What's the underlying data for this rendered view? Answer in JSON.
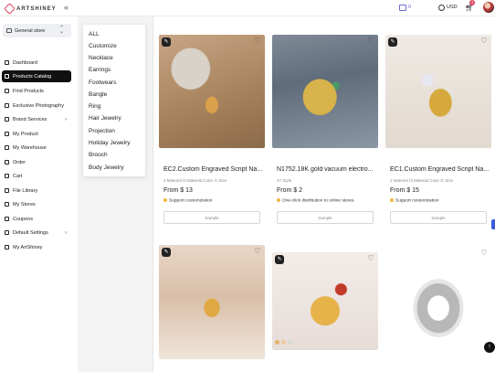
{
  "app": {
    "logo_text": "ARTSHINEY",
    "collapse_icon": "double-chevron-left"
  },
  "topbar": {
    "box_count": "0",
    "currency": "USD",
    "cart_badge": "3"
  },
  "sidebar": {
    "store_label": "General store",
    "items": [
      {
        "label": "Dashboard"
      },
      {
        "label": "Products Catalog",
        "active": true
      },
      {
        "label": "Find Products"
      },
      {
        "label": "Exclusive Photography"
      },
      {
        "label": "Brand Services",
        "has_submenu": true
      },
      {
        "label": "My Product"
      },
      {
        "label": "My Warehouse"
      },
      {
        "label": "Order"
      },
      {
        "label": "Cart"
      },
      {
        "label": "File Library"
      },
      {
        "label": "My Stores"
      },
      {
        "label": "Coupons"
      },
      {
        "label": "Default Settings",
        "has_submenu": true
      },
      {
        "label": "My ArtShiney"
      }
    ]
  },
  "category_menu": {
    "items": [
      "ALL",
      "Customize",
      "Necklace",
      "Earrings",
      "Footwears",
      "Bangle",
      "Ring",
      "Hair Jewelry",
      "Projection",
      "Holiday Jewelry",
      "Brooch",
      "Body Jewelry"
    ]
  },
  "products": [
    {
      "title": "EC2.Custom Engraved Script Na...",
      "meta": "2 Material /3 Material Color /1 Size",
      "price": "From $ 13",
      "note": "Support customization",
      "button": "Sample",
      "customizable": true
    },
    {
      "title": "N1752.18K gold vacuum electro...",
      "meta": "47 Style",
      "price": "From $ 2",
      "note": "One-click distribution to online stores",
      "button": "Sample",
      "customizable": false
    },
    {
      "title": "EC1.Custom Engraved Script Na...",
      "meta": "1 Material /3 Material Color /1 Size",
      "price": "From $ 15",
      "note": "Support customization",
      "button": "Sample",
      "customizable": true
    },
    {
      "customizable": true
    },
    {
      "customizable": true
    },
    {
      "customizable": false
    }
  ],
  "colors": {
    "accent_red": "#e0455d",
    "active_nav": "#111111",
    "box_icon": "#6c6cd6",
    "scroll_tab": "#3b5bdb"
  }
}
